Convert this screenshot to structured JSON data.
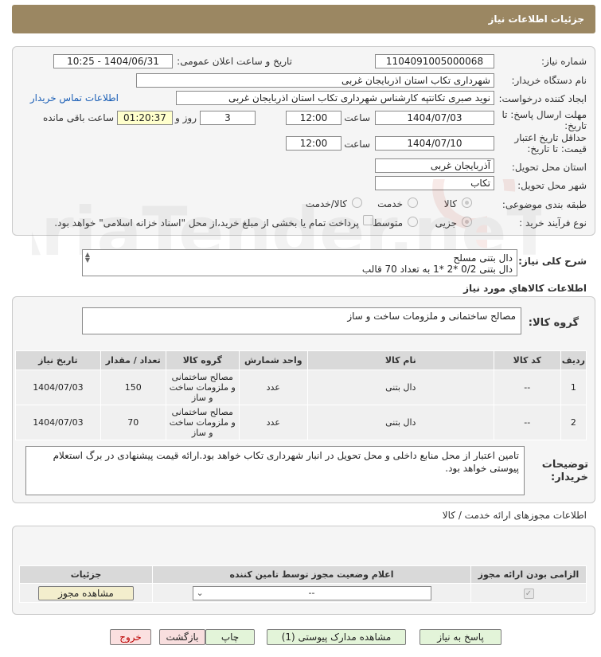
{
  "header": {
    "title": "جزئیات اطلاعات نیاز"
  },
  "form": {
    "need_number_label": "شماره نیاز:",
    "need_number": "1104091005000068",
    "announce_label": "تاریخ و ساعت اعلان عمومی:",
    "announce_value": "1404/06/31 - 10:25",
    "buyer_label": "نام دستگاه خریدار:",
    "buyer_value": "شهرداری تکاب استان اذربایجان غربی",
    "creator_label": "ایجاد کننده درخواست:",
    "creator_value": "نوید صبری تکانتپه کارشناس شهرداری تکاب استان اذربایجان غربی",
    "contact_link": "اطلاعات تماس خریدار",
    "reply_deadline_label": "مهلت ارسال پاسخ: تا تاریخ:",
    "reply_date": "1404/07/03",
    "time_label": "ساعت",
    "reply_time": "12:00",
    "days": "3",
    "days_label": "روز و",
    "remaining": "01:20:37",
    "remaining_label": "ساعت باقی مانده",
    "validity_label": "حداقل تاریخ اعتبار قیمت: تا تاریخ:",
    "validity_date": "1404/07/10",
    "validity_time": "12:00",
    "province_label": "استان محل تحویل:",
    "province_value": "آذربایجان غربی",
    "city_label": "شهر محل تحویل:",
    "city_value": "تکاب",
    "category_label": "طبقه بندی موضوعی:",
    "category_options": [
      "کالا",
      "خدمت",
      "کالا/خدمت"
    ],
    "process_label": "نوع فرآیند خرید :",
    "process_options": [
      "جزیی",
      "متوسط"
    ],
    "payment_note": "پرداخت تمام یا بخشی از مبلغ خرید،از محل \"اسناد خزانه اسلامی\" خواهد بود."
  },
  "description": {
    "label": "شرح کلی نیاز:",
    "line1": "دال بتنی مسلح",
    "line2": "دال بتنی 0/2 *2 *1 به تعداد 70 قالب"
  },
  "goods": {
    "section_title": "اطلاعات کالاهاي مورد نياز",
    "group_label": "گروه کالا:",
    "group_value": "مصالح ساختمانی و ملزومات ساخت و ساز",
    "columns": [
      "ردیف",
      "کد کالا",
      "نام کالا",
      "واحد شمارش",
      "گروه کالا",
      "تعداد / مقدار",
      "تاریخ نیاز"
    ],
    "rows": [
      {
        "idx": "1",
        "code": "--",
        "name": "دال بتنی",
        "unit": "عدد",
        "group": "مصالح ساختمانی و ملزومات ساخت و ساز",
        "qty": "150",
        "date": "1404/07/03"
      },
      {
        "idx": "2",
        "code": "--",
        "name": "دال بتنی",
        "unit": "عدد",
        "group": "مصالح ساختمانی و ملزومات ساخت و ساز",
        "qty": "70",
        "date": "1404/07/03"
      }
    ]
  },
  "buyer_notes": {
    "label": "توضیحات خریدار:",
    "text": "تامین اعتبار از محل منابع داخلی و محل تحویل در انبار شهرداری تکاب خواهد بود.ارائه قیمت پیشنهادی در برگ استعلام پیوستی خواهد بود."
  },
  "licenses": {
    "section_title": "اطلاعات مجوزهای ارائه خدمت / کالا",
    "columns": [
      "الزامی بودن ارائه مجوز",
      "اعلام وضعیت مجوز توسط تامین کننده",
      "جزئیات"
    ],
    "select_value": "--",
    "view_button": "مشاهده مجوز"
  },
  "buttons": {
    "reply": "پاسخ به نیاز",
    "attachments": "مشاهده مدارک پیوستی (1)",
    "print": "چاپ",
    "back": "بازگشت",
    "exit": "خروج"
  },
  "watermark": "AriaTender.neT",
  "colors": {
    "header": "#9b8762",
    "link": "#1b5fb6",
    "yellow_field": "#ffffcc"
  }
}
